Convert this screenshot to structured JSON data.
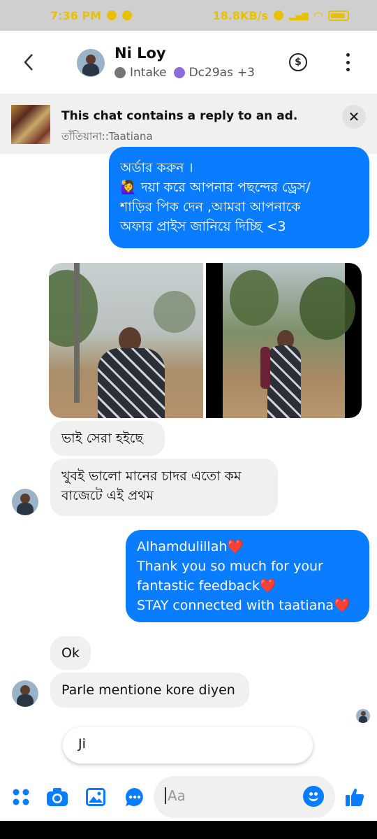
{
  "status_bar": {
    "time": "7:36 PM",
    "network_speed": "18.8KB/s"
  },
  "header": {
    "contact_name": "Ni Loy",
    "tags": [
      {
        "label": "Intake",
        "color": "#777777"
      },
      {
        "label": "Dc29as",
        "color": "#8e6bd9"
      }
    ],
    "more_tags": "+3",
    "payment_icon": "dollar-circle-icon",
    "menu_icon": "kebab-menu-icon"
  },
  "ad_banner": {
    "title": "This chat contains a reply to an ad.",
    "page_name": "তাঁতিয়ানা::Taatiana",
    "close_label": "✕"
  },
  "messages": {
    "outgoing_1": {
      "line1": "অর্ডার করুন ।",
      "line2": "🙋‍♀️ দয়া করে আপনার পছন্দের ড্রেস/",
      "line3": "শাড়ির পিক দেন ,আমরা আপনাকে",
      "line4": "অফার প্রাইস জানিয়ে দিচ্ছি <3"
    },
    "incoming_1": "ভাই সেরা হইছে",
    "incoming_2": {
      "line1": "খুবই ভালো মানের চাদর এতো কম",
      "line2": "বাজেটে এই প্রথম"
    },
    "outgoing_2": {
      "line1": "Alhamdulillah",
      "line2": "Thank you so much for your",
      "line3": "fantastic feedback",
      "line4": "STAY connected with taatiana",
      "heart": "❤️"
    },
    "incoming_3": "Ok",
    "incoming_4": "Parle mentione kore diyen"
  },
  "quick_reply": "Ji",
  "composer": {
    "placeholder": "Aa",
    "icons": [
      "apps-icon",
      "camera-icon",
      "gallery-icon",
      "chat-icon",
      "emoji-icon",
      "thumbs-up-icon"
    ],
    "accent": "#0a7cff"
  }
}
